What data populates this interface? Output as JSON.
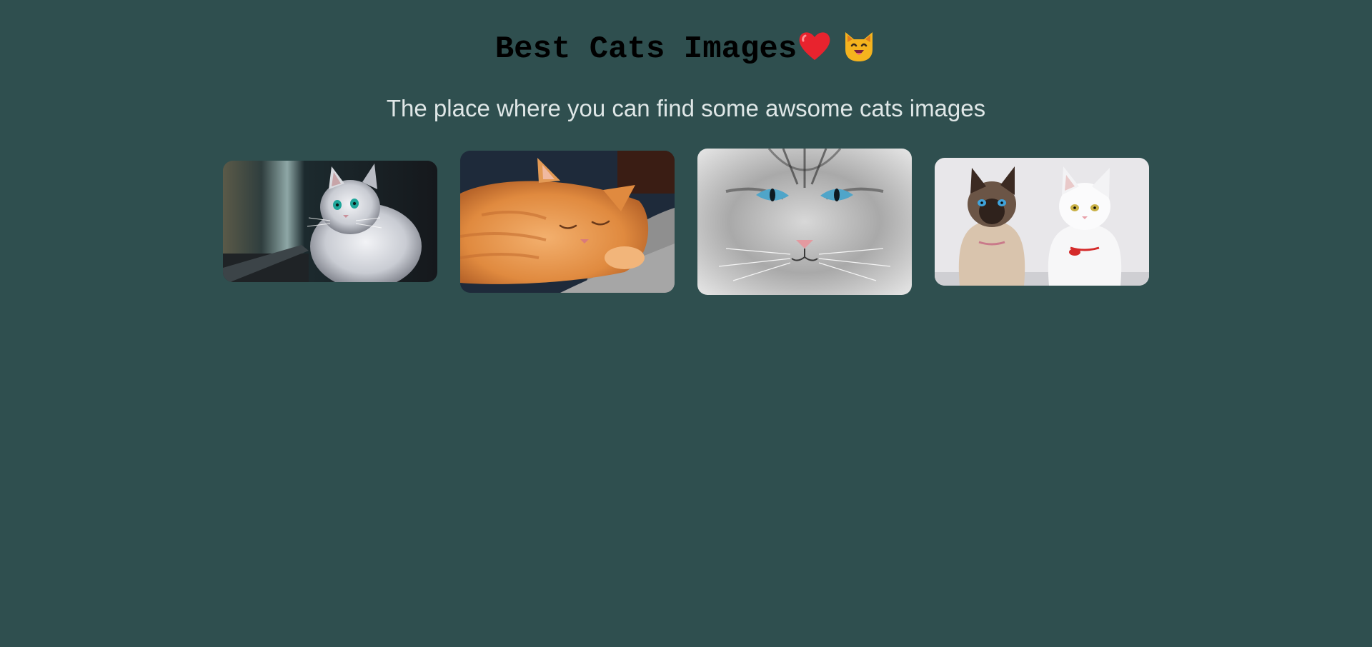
{
  "header": {
    "title": "Best Cats Images",
    "heart_icon": "red-heart-icon",
    "cat_icon": "smiling-cat-face-icon"
  },
  "subtitle": "The place where you can find some awsome cats images",
  "colors": {
    "background": "#2f4f4f",
    "title": "#000000",
    "subtitle": "#dfe7e7"
  },
  "gallery": {
    "images": [
      {
        "description": "white fluffy cat looking out a window"
      },
      {
        "description": "orange tabby cat sleeping on a grey blanket"
      },
      {
        "description": "close-up of grey cat face with blue eyes"
      },
      {
        "description": "siamese cat and white cat side by side"
      }
    ]
  }
}
